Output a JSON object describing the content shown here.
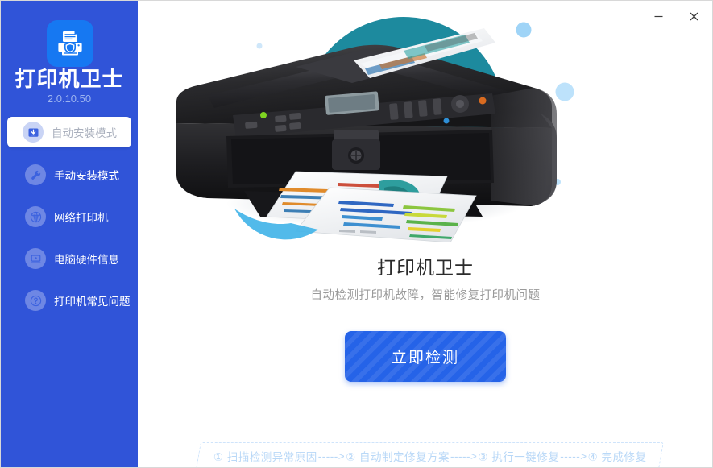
{
  "window": {
    "minimize_label": "—",
    "close_label": "✕",
    "minimize_icon": "minimize-icon",
    "close_icon": "close-icon"
  },
  "sidebar": {
    "brand_name": "打印机卫士",
    "version": "2.0.10.50",
    "logo_icon": "printer-shield-logo-icon",
    "background_color": "#3054D8",
    "items": [
      {
        "label": "自动安装模式",
        "icon": "download-box-icon",
        "active": true
      },
      {
        "label": "手动安装模式",
        "icon": "wrench-icon",
        "active": false
      },
      {
        "label": "网络打印机",
        "icon": "network-printer-icon",
        "active": false
      },
      {
        "label": "电脑硬件信息",
        "icon": "monitor-icon",
        "active": false
      },
      {
        "label": "打印机常见问题",
        "icon": "question-mark-icon",
        "active": false
      }
    ]
  },
  "hero": {
    "illustration_name": "printer-illustration",
    "teal_circle_color": "#1D8A9E",
    "dot_colors": [
      "#4FB3F2",
      "#9FD4F7",
      "#BDE2FB",
      "#5CBDF5"
    ]
  },
  "main": {
    "title": "打印机卫士",
    "subtitle": "自动检测打印机故障，智能修复打印机问题",
    "cta_label": "立即检测",
    "cta_color": "#2563E8"
  },
  "steps_bar": {
    "border_color": "#CFE4FB",
    "text_color": "#B9D8F7",
    "arrow": "----->",
    "steps": [
      "① 扫描检测异常原因",
      "② 自动制定修复方案",
      "③ 执行一键修复",
      "④ 完成修复"
    ]
  }
}
